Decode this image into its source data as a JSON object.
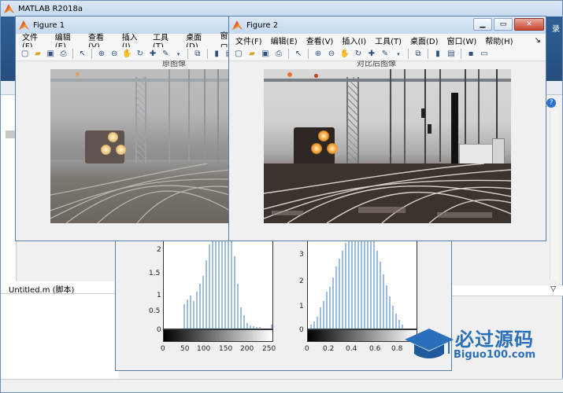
{
  "desktop": {
    "main_title": "MATLAB R2018a",
    "editor_tab": "Untitled.m  (脚本)",
    "corner_text": "录"
  },
  "figure1": {
    "title": "Figure 1",
    "image_title": "原图像"
  },
  "figure2": {
    "title": "Figure 2",
    "image_title": "对比后图像"
  },
  "menus": [
    "文件(F)",
    "编辑(E)",
    "查看(V)",
    "插入(I)",
    "工具(T)",
    "桌面(D)",
    "窗口(W)",
    "帮助(H)"
  ],
  "figure1_menus_visible": [
    "文件(F)",
    "编辑(E)",
    "查看(V)",
    "插入(I)",
    "工具(T)",
    "桌面(D)",
    "窗口"
  ],
  "histograms": {
    "left_ytick": [
      "2",
      "1.5",
      "1",
      "0.5",
      "0"
    ],
    "left_xtick": [
      "0",
      "50",
      "100",
      "150",
      "200",
      "250"
    ],
    "right_ytick": [
      "3",
      "2",
      "1",
      "0"
    ],
    "right_xtick": [
      "0",
      "0.2",
      "0.4",
      "0.6",
      "0.8"
    ]
  },
  "watermark": {
    "cn": "必过源码",
    "en": "Biguo100.com"
  }
}
